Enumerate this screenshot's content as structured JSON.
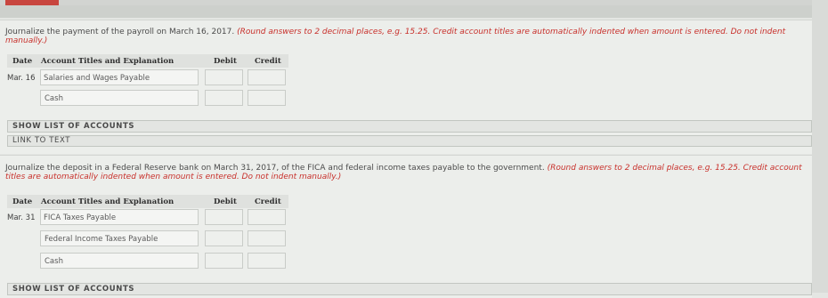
{
  "question1": {
    "text": "Journalize the payment of the payroll on March 16, 2017.",
    "note": "(Round answers to 2 decimal places, e.g. 15.25. Credit account titles are automatically indented when amount is entered. Do not indent manually.)",
    "headers": {
      "date": "Date",
      "account": "Account Titles and Explanation",
      "debit": "Debit",
      "credit": "Credit"
    },
    "rows": [
      {
        "date": "Mar. 16",
        "account": "Salaries and Wages Payable",
        "debit": "",
        "credit": ""
      },
      {
        "date": "",
        "account": "Cash",
        "debit": "",
        "credit": ""
      }
    ],
    "show_accounts_label": "SHOW LIST OF ACCOUNTS",
    "link_to_text_label": "LINK TO TEXT"
  },
  "question2": {
    "text": "Journalize the deposit in a Federal Reserve bank on March 31, 2017, of the FICA and federal income taxes payable to the government.",
    "note": "(Round answers to 2 decimal places, e.g. 15.25. Credit account titles are automatically indented when amount is entered. Do not indent manually.)",
    "headers": {
      "date": "Date",
      "account": "Account Titles and Explanation",
      "debit": "Debit",
      "credit": "Credit"
    },
    "rows": [
      {
        "date": "Mar. 31",
        "account": "FICA Taxes Payable",
        "debit": "",
        "credit": ""
      },
      {
        "date": "",
        "account": "Federal Income Taxes Payable",
        "debit": "",
        "credit": ""
      },
      {
        "date": "",
        "account": "Cash",
        "debit": "",
        "credit": ""
      }
    ],
    "show_accounts_label": "SHOW LIST OF ACCOUNTS"
  }
}
